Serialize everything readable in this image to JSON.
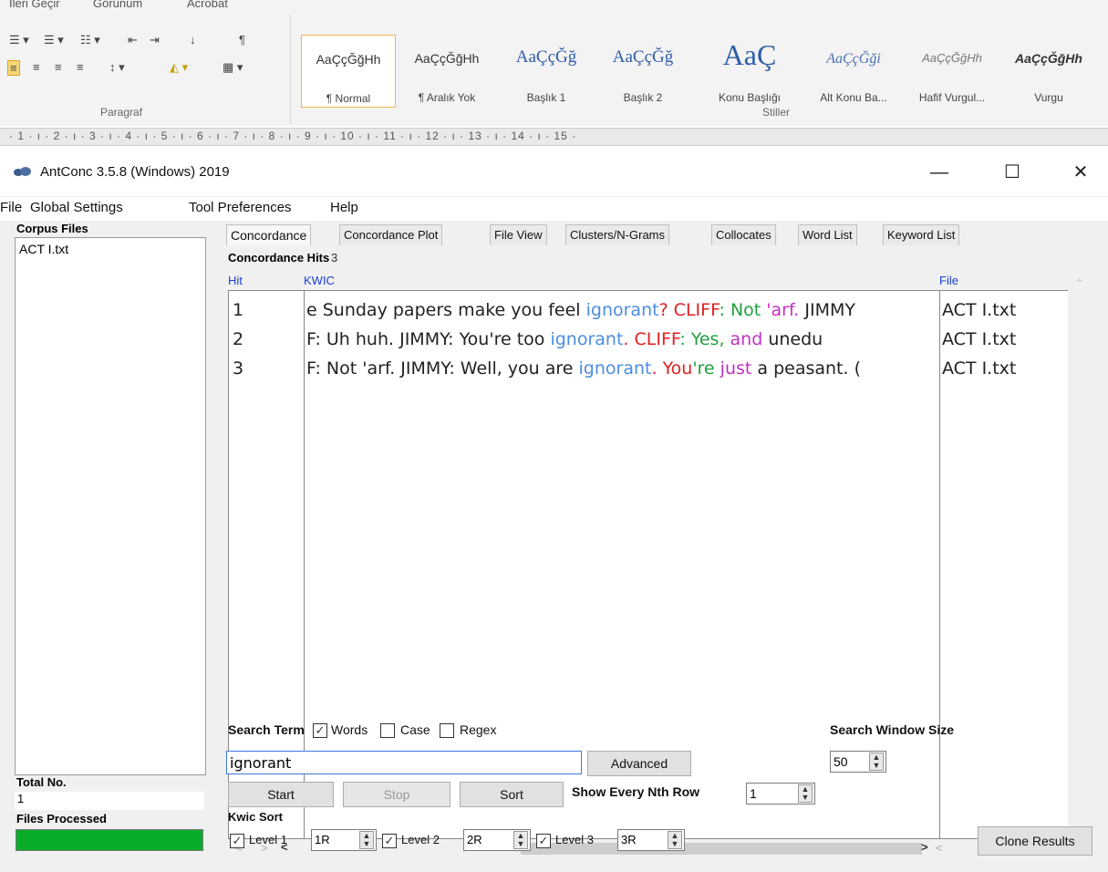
{
  "word": {
    "top_tabs": [
      "İleri Geçir",
      "Görünüm",
      "Acrobat"
    ],
    "paragraph_label": "Paragraf",
    "styles_label": "Stiller",
    "styles": [
      {
        "sample": "AaÇçĞğHh",
        "name": "¶ Normal"
      },
      {
        "sample": "AaÇçĞğHh",
        "name": "¶ Aralık Yok"
      },
      {
        "sample": "AaÇçĞğ",
        "name": "Başlık 1"
      },
      {
        "sample": "AaÇçĞğ",
        "name": "Başlık 2"
      },
      {
        "sample": "AaÇ",
        "name": "Konu Başlığı"
      },
      {
        "sample": "AaÇçĞği",
        "name": "Alt Konu Ba..."
      },
      {
        "sample": "AaÇçĞğHh",
        "name": "Hafif Vurgul..."
      },
      {
        "sample": "AaÇçĞğHh",
        "name": "Vurgu"
      }
    ],
    "ruler": "· 1 · ı · 2 · ı · 3 · ı · 4 · ı · 5 · ı · 6 · ı · 7 · ı · 8 · ı · 9 · ı · 10 · ı · 11 · ı · 12 · ı · 13 · ı · 14 · ı · 15 ·"
  },
  "window": {
    "title": "AntConc 3.5.8 (Windows) 2019",
    "minimize": "—",
    "maximize": "☐",
    "close": "✕"
  },
  "menu": [
    "File",
    "Global Settings",
    "Tool Preferences",
    "Help"
  ],
  "corpus": {
    "label": "Corpus Files",
    "files": [
      "ACT I.txt"
    ],
    "total_label": "Total No.",
    "total_value": "1",
    "files_processed_label": "Files Processed"
  },
  "tabs": [
    "Concordance",
    "Concordance Plot",
    "File View",
    "Clusters/N-Grams",
    "Collocates",
    "Word List",
    "Keyword List"
  ],
  "concordance": {
    "hits_label": "Concordance Hits",
    "hits_count": "3",
    "col_hit": "Hit",
    "col_kwic": "KWIC",
    "col_file": "File",
    "rows": [
      {
        "hit": "1",
        "left": "e Sunday papers make you feel ",
        "kw": "ignorant",
        "r1": "? CLIFF",
        "r2": ": Not",
        "r3": " 'arf.",
        "rest": " JIMMY",
        "file": "ACT I.txt"
      },
      {
        "hit": "2",
        "left": "F: Uh   huh. JIMMY: You're   too ",
        "kw": "ignorant",
        "r1": ". CLIFF",
        "r2": ": Yes,",
        "r3": "   and",
        "rest": " unedu",
        "file": "ACT I.txt"
      },
      {
        "hit": "3",
        "left": "F: Not 'arf. JIMMY: Well, you are ",
        "kw": "ignorant",
        "r1": ". You",
        "r2": "'re",
        "r3": " just",
        "rest": " a peasant. (",
        "file": "ACT I.txt"
      }
    ]
  },
  "search": {
    "term_label": "Search Term",
    "words_label": "Words",
    "words_checked": true,
    "case_label": "Case",
    "regex_label": "Regex",
    "term_value": "ignorant",
    "advanced_label": "Advanced",
    "window_size_label": "Search Window Size",
    "window_size_value": "50",
    "start_label": "Start",
    "stop_label": "Stop",
    "sort_label": "Sort",
    "nth_row_label": "Show Every Nth Row",
    "nth_row_value": "1"
  },
  "kwic_sort": {
    "label": "Kwic Sort",
    "levels": [
      {
        "label": "Level 1",
        "value": "1R"
      },
      {
        "label": "Level 2",
        "value": "2R"
      },
      {
        "label": "Level 3",
        "value": "3R"
      }
    ],
    "clone_label": "Clone Results"
  },
  "colors": {
    "keyword": "#4b8de0",
    "sort1": "#e02020",
    "sort2": "#20a040",
    "sort3": "#c030c0",
    "progress": "#08ae2a"
  },
  "progress": 1.0
}
